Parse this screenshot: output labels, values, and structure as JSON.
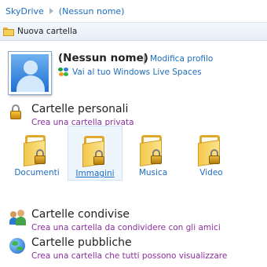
{
  "breadcrumb": {
    "root": "SkyDrive",
    "current": "(Nessun nome)"
  },
  "toolbar": {
    "new_folder": "Nuova cartella"
  },
  "profile": {
    "name": "(Nessun nome)",
    "separator": "|",
    "edit_link": "Modifica profilo",
    "spaces_link": "Vai al tuo Windows Live Spaces"
  },
  "personal": {
    "title": "Cartelle personali",
    "link": "Crea una cartella privata",
    "folders": [
      "Documenti",
      "Immagini",
      "Musica",
      "Video"
    ],
    "selected_folder": "Immagini"
  },
  "shared": {
    "title": "Cartelle condivise",
    "link": "Crea una cartella da condividere con gli amici"
  },
  "public": {
    "title": "Cartelle pubbliche",
    "link": "Crea una cartella che tutti possono visualizzare"
  },
  "colors": {
    "link_blue": "#1d6cbf",
    "visited_purple": "#8b2fa0",
    "folder_yellow": "#f5cf5a"
  },
  "icons": {
    "toolbar": "folder-icon",
    "personal": "lock-icon",
    "shared": "people-icon",
    "public": "globe-icon",
    "spaces": "windows-live-butterfly-icon"
  }
}
